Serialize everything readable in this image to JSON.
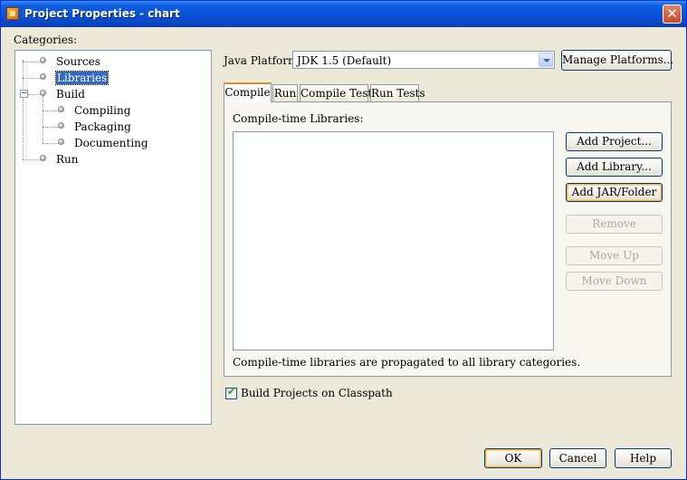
{
  "window": {
    "title": "Project Properties - chart",
    "close_glyph": "✕"
  },
  "categories": {
    "label": "Categories:",
    "tree": [
      {
        "label": "Sources"
      },
      {
        "label": "Libraries",
        "selected": true
      },
      {
        "label": "Build",
        "expanded": true
      },
      {
        "label": "Compiling"
      },
      {
        "label": "Packaging"
      },
      {
        "label": "Documenting"
      },
      {
        "label": "Run"
      }
    ]
  },
  "platform": {
    "label": "Java Platform:",
    "value": "JDK 1.5 (Default)",
    "manage_label": "Manage Platforms..."
  },
  "tabs": [
    {
      "label": "Compile",
      "active": true
    },
    {
      "label": "Run"
    },
    {
      "label": "Compile Tests"
    },
    {
      "label": "Run Tests"
    }
  ],
  "compile": {
    "list_label": "Compile-time Libraries:",
    "footer": "Compile-time libraries are propagated to all library categories.",
    "buttons": [
      {
        "label": "Add Project...",
        "enabled": true
      },
      {
        "label": "Add Library...",
        "enabled": true
      },
      {
        "label": "Add JAR/Folder",
        "enabled": true,
        "focused": true
      },
      {
        "label": "Remove",
        "enabled": false
      },
      {
        "label": "Move Up",
        "enabled": false
      },
      {
        "label": "Move Down",
        "enabled": false
      }
    ]
  },
  "build_on_classpath": {
    "label": "Build Projects on Classpath",
    "checked": true
  },
  "dialog_buttons": {
    "ok": "OK",
    "cancel": "Cancel",
    "help": "Help"
  },
  "colors": {
    "title_bar": "#0a52d8",
    "selection": "#316ac5",
    "face": "#ece9d8"
  }
}
